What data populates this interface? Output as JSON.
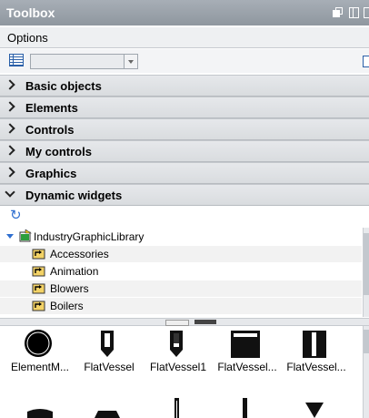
{
  "window": {
    "title": "Toolbox"
  },
  "options": {
    "label": "Options",
    "combo_value": ""
  },
  "categories": [
    {
      "label": "Basic objects",
      "expanded": false
    },
    {
      "label": "Elements",
      "expanded": false
    },
    {
      "label": "Controls",
      "expanded": false
    },
    {
      "label": "My controls",
      "expanded": false
    },
    {
      "label": "Graphics",
      "expanded": false
    },
    {
      "label": "Dynamic widgets",
      "expanded": true
    }
  ],
  "tree": {
    "root": {
      "label": "IndustryGraphicLibrary"
    },
    "children": [
      {
        "label": "Accessories"
      },
      {
        "label": "Animation"
      },
      {
        "label": "Blowers"
      },
      {
        "label": "Boilers"
      }
    ]
  },
  "gallery": {
    "items": [
      {
        "label": "ElementM...",
        "icon": "element-meter-icon"
      },
      {
        "label": "FlatVessel",
        "icon": "flat-vessel-icon"
      },
      {
        "label": "FlatVessel1",
        "icon": "flat-vessel1-icon"
      },
      {
        "label": "FlatVessel...",
        "icon": "flat-vessel-2-icon"
      },
      {
        "label": "FlatVessel...",
        "icon": "flat-vessel-3-icon"
      }
    ]
  },
  "colors": {
    "titlebar": "#9aa1a9",
    "accent": "#2f6fd0",
    "category_bg": "#e0e3e6"
  }
}
